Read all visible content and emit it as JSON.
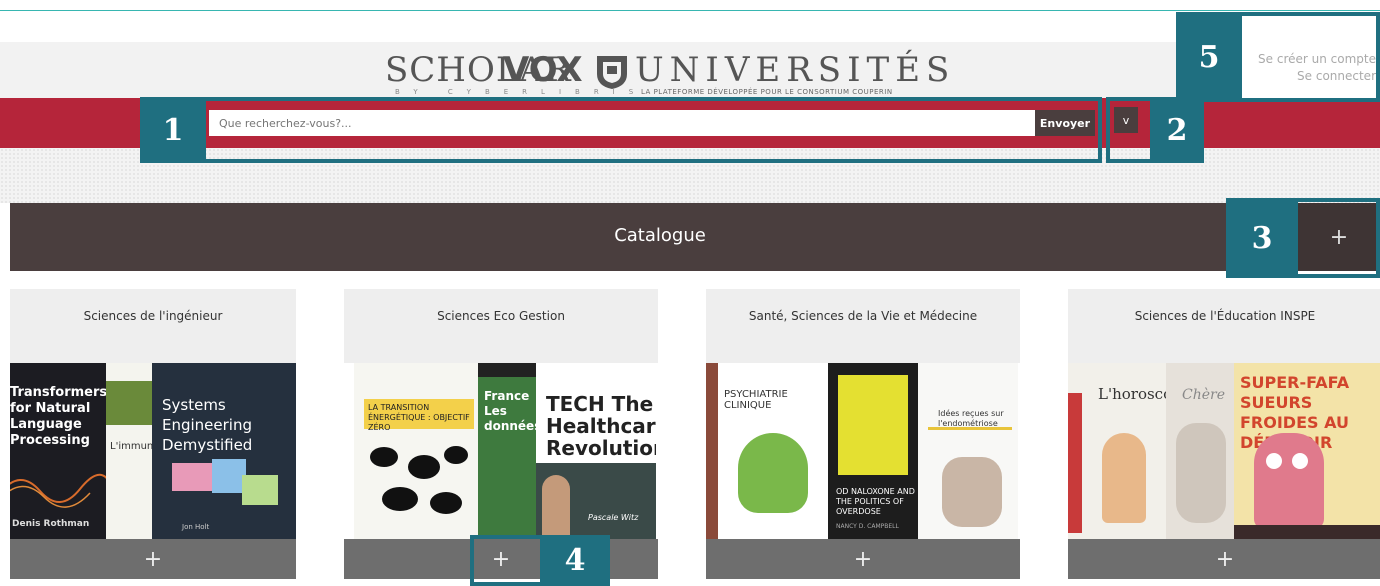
{
  "header": {
    "logo": {
      "scholar": "SCHOLAR",
      "vox": "VOX",
      "universites": "UNIVERSITÉS",
      "by_line": "BY CYBERLIBRIS",
      "tagline": "LA PLATEFORME DÉVELOPPÉE POUR LE CONSORTIUM COUPERIN"
    },
    "account": {
      "create_account": "Se créer un compte",
      "login": "Se connecter"
    }
  },
  "search": {
    "placeholder": "Que recherchez-vous?...",
    "value": "",
    "submit_label": "Envoyer",
    "advanced_toggle": "v"
  },
  "catalogue": {
    "title": "Catalogue",
    "expand_label": "+"
  },
  "categories": [
    {
      "title": "Sciences de l'ingénieur",
      "expand_label": "+",
      "covers": [
        {
          "text": "Transformers for Natural Language Processing",
          "author": "Denis Rothman"
        },
        {
          "text": "L'immunité",
          "author": ""
        },
        {
          "text": "Systems Engineering Demystified",
          "author": "Jon Holt"
        }
      ]
    },
    {
      "title": "Sciences Eco Gestion",
      "expand_label": "+",
      "covers": [
        {
          "text": "LA TRANSITION ÉNERGÉTIQUE : OBJECTIF ZÉRO",
          "author": ""
        },
        {
          "text": "France Les données",
          "author": ""
        },
        {
          "text": "TECH The Healthcare Revolution",
          "author": "Pascale Witz"
        }
      ]
    },
    {
      "title": "Santé, Sciences de la Vie et Médecine",
      "expand_label": "+",
      "covers": [
        {
          "text": "PSYCHIATRIE CLINIQUE",
          "author": ""
        },
        {
          "text": "OD NALOXONE AND THE POLITICS OF OVERDOSE",
          "author": "NANCY D. CAMPBELL"
        },
        {
          "text": "Idées reçues sur l'endométriose",
          "author": ""
        }
      ]
    },
    {
      "title": "Sciences de l'Éducation INSPE",
      "expand_label": "+",
      "covers": [
        {
          "text": "L'horoscope",
          "author": ""
        },
        {
          "text": "Chère",
          "author": ""
        },
        {
          "text": "SUPER-FAFA SUEURS FROIDES AU DÉPOTOIR",
          "author": ""
        }
      ]
    }
  ],
  "callouts": [
    "1",
    "2",
    "3",
    "4",
    "5"
  ],
  "colors": {
    "accent_red": "#b5253a",
    "dark_bar": "#4a3e3e",
    "callout_teal": "#1f6f80"
  }
}
